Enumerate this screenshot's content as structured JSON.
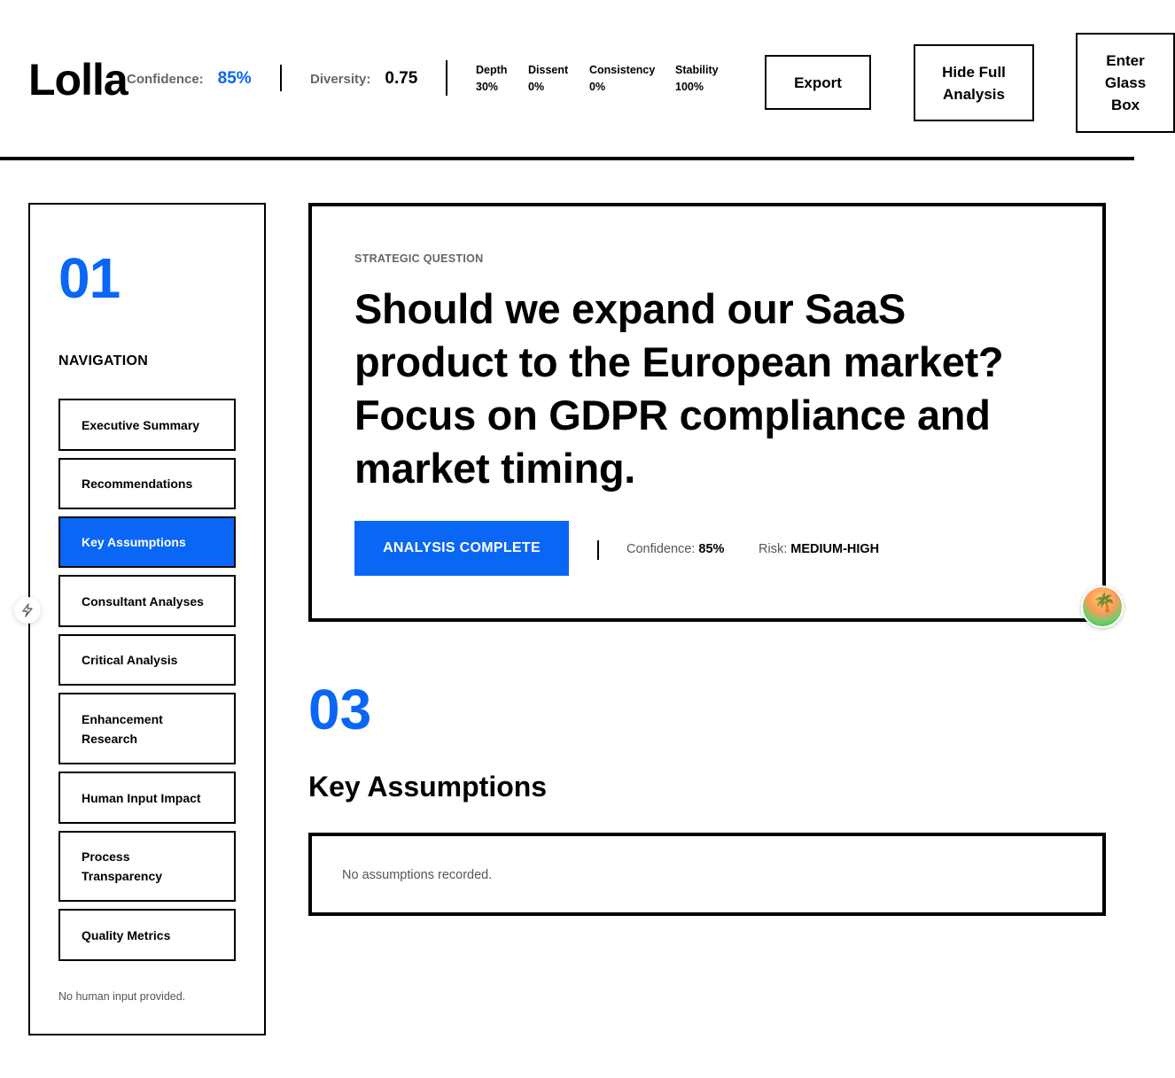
{
  "header": {
    "logo": "Lolla",
    "confidence_label": "Confidence:",
    "confidence_value": "85%",
    "diversity_label": "Diversity:",
    "diversity_value": "0.75",
    "metrics": [
      {
        "label": "Depth",
        "value": "30%"
      },
      {
        "label": "Dissent",
        "value": "0%"
      },
      {
        "label": "Consistency",
        "value": "0%"
      },
      {
        "label": "Stability",
        "value": "100%"
      }
    ],
    "buttons": {
      "export": "Export",
      "hide_full_analysis": "Hide Full Analysis",
      "enter_glass_box": "Enter Glass Box"
    }
  },
  "sidebar": {
    "number": "01",
    "title": "NAVIGATION",
    "items": [
      {
        "label": "Executive Summary",
        "active": false
      },
      {
        "label": "Recommendations",
        "active": false
      },
      {
        "label": "Key Assumptions",
        "active": true
      },
      {
        "label": "Consultant Analyses",
        "active": false
      },
      {
        "label": "Critical Analysis",
        "active": false
      },
      {
        "label": "Enhancement Research",
        "active": false
      },
      {
        "label": "Human Input Impact",
        "active": false
      },
      {
        "label": "Process Transparency",
        "active": false
      },
      {
        "label": "Quality Metrics",
        "active": false
      }
    ],
    "note": "No human input provided."
  },
  "question_card": {
    "kicker": "STRATEGIC QUESTION",
    "question": "Should we expand our SaaS product to the European market? Focus on GDPR compliance and market timing.",
    "status": "ANALYSIS COMPLETE",
    "confidence_label": "Confidence:",
    "confidence_value": "85%",
    "risk_label": "Risk:",
    "risk_value": "MEDIUM-HIGH"
  },
  "section": {
    "number": "03",
    "title": "Key Assumptions",
    "empty_message": "No assumptions recorded."
  },
  "colors": {
    "accent": "#0a66f5",
    "text": "#000000",
    "muted": "#555555"
  },
  "icons": {
    "floating_left": "lightning-icon",
    "avatar": "palm-island-avatar-icon"
  }
}
